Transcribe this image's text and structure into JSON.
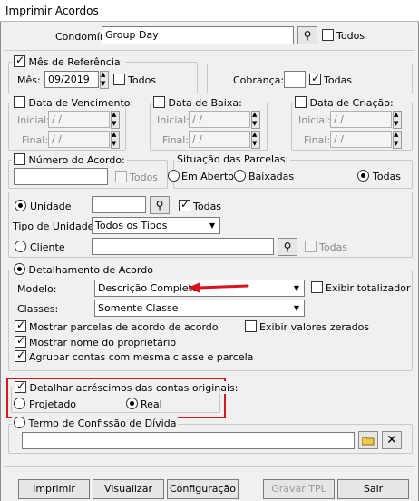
{
  "window": {
    "title": "Imprimir Acordos"
  },
  "condominio": {
    "label": "Condomínio:",
    "value": "Group Day",
    "todos": "Todos"
  },
  "mes_referencia": {
    "legend": "Mês de Referência:",
    "mes_label": "Mês:",
    "mes_value": "09/2019",
    "todos": "Todos"
  },
  "cobranca": {
    "label": "Cobrança:",
    "todas": "Todas"
  },
  "data_vencimento": {
    "legend": "Data de Vencimento:",
    "inicial": "Inicial:",
    "final": "Final:",
    "placeholder": " / /"
  },
  "data_baixa": {
    "legend": "Data de Baixa:",
    "inicial": "Inicial:",
    "final": "Final:",
    "placeholder": " / /"
  },
  "data_criacao": {
    "legend": "Data de Criação:",
    "inicial": "Inicial:",
    "final": "Final:",
    "placeholder": " / /"
  },
  "numero_acordo": {
    "legend": "Número do Acordo:",
    "todos": "Todos"
  },
  "situacao": {
    "legend": "Situação das Parcelas:",
    "em_aberto": "Em Aberto",
    "baixadas": "Baixadas",
    "todas": "Todas"
  },
  "unidade": {
    "label": "Unidade",
    "todas": "Todas",
    "tipo_label": "Tipo de Unidade:",
    "tipo_value": "Todos os Tipos",
    "cliente": "Cliente",
    "cliente_todas": "Todas"
  },
  "detalhamento": {
    "legend": "Detalhamento de Acordo",
    "modelo_label": "Modelo:",
    "modelo_value": "Descrição Completa",
    "exibir_totalizador": "Exibir totalizador",
    "classes_label": "Classes:",
    "classes_value": "Somente Classe",
    "mostrar_parcelas": "Mostrar parcelas de acordo de acordo",
    "exibir_zerados": "Exibir valores zerados",
    "mostrar_nome": "Mostrar nome do proprietário",
    "agrupar": "Agrupar contas com mesma classe e parcela"
  },
  "acrescimos": {
    "legend": "Detalhar acréscimos das contas originais:",
    "projetado": "Projetado",
    "real": "Real"
  },
  "termo": {
    "legend": "Termo de Confissão de Dívida"
  },
  "buttons": {
    "imprimir": "Imprimir",
    "visualizar": "Visualizar",
    "configuracao": "Configuração",
    "gravar_tpl": "Gravar TPL",
    "sair": "Sair"
  },
  "colors": {
    "highlight_red": "#d9141c"
  }
}
